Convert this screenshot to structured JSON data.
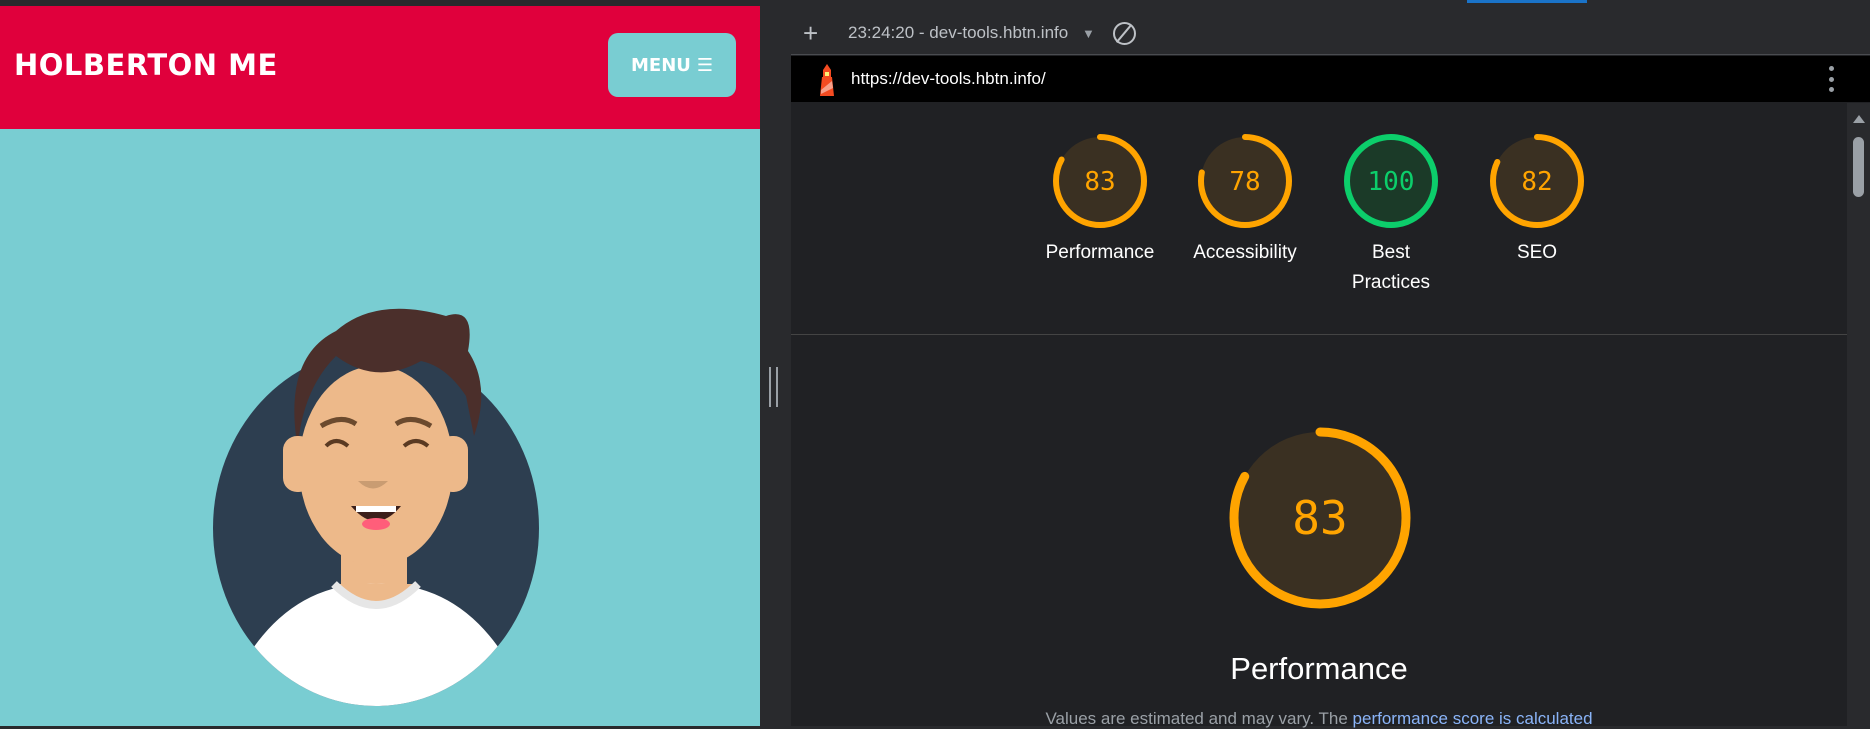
{
  "site": {
    "title": "HOLBERTON ME",
    "menu_label": "MENU",
    "menu_icon": "hamburger-icon"
  },
  "devtools": {
    "report_select": "23:24:20 - dev-tools.hbtn.info",
    "url": "https://dev-tools.hbtn.info/",
    "gauges": [
      {
        "label": "Performance",
        "score": 83,
        "color": "#ffa400"
      },
      {
        "label": "Accessibility",
        "score": 78,
        "color": "#ffa400"
      },
      {
        "label": "Best Practices",
        "score": 100,
        "color": "#0cce6b"
      },
      {
        "label": "SEO",
        "score": 82,
        "color": "#ffa400"
      }
    ],
    "section": {
      "score": 83,
      "title": "Performance",
      "note_prefix": "Values are estimated and may vary. The ",
      "note_link": "performance score is calculated"
    }
  }
}
